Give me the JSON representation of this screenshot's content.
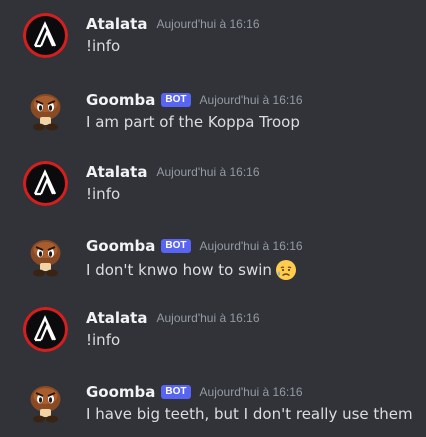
{
  "colors": {
    "background": "#313338",
    "username": "#f2f3f5",
    "message_text": "#dbdee1",
    "timestamp": "#949ba4",
    "bot_tag": "#5865f2",
    "atalata_avatar_ring": "#d51f1f"
  },
  "messages": [
    {
      "author": "Atalata",
      "avatar_icon": "atalata-logo-icon",
      "is_bot": false,
      "timestamp": "Aujourd'hui à 16:16",
      "text": "!info"
    },
    {
      "author": "Goomba",
      "avatar_icon": "goomba-icon",
      "is_bot": true,
      "bot_label": "BOT",
      "timestamp": "Aujourd'hui à 16:16",
      "text": "I am part of the Koppa Troop"
    },
    {
      "author": "Atalata",
      "avatar_icon": "atalata-logo-icon",
      "is_bot": false,
      "timestamp": "Aujourd'hui à 16:16",
      "text": "!info"
    },
    {
      "author": "Goomba",
      "avatar_icon": "goomba-icon",
      "is_bot": true,
      "bot_label": "BOT",
      "timestamp": "Aujourd'hui à 16:16",
      "text": "I don't knwo how to swin",
      "emoji": "sad-but-relieved-face-emoji"
    },
    {
      "author": "Atalata",
      "avatar_icon": "atalata-logo-icon",
      "is_bot": false,
      "timestamp": "Aujourd'hui à 16:16",
      "text": "!info"
    },
    {
      "author": "Goomba",
      "avatar_icon": "goomba-icon",
      "is_bot": true,
      "bot_label": "BOT",
      "timestamp": "Aujourd'hui à 16:16",
      "text": "I have big teeth, but I don't really use them"
    }
  ]
}
